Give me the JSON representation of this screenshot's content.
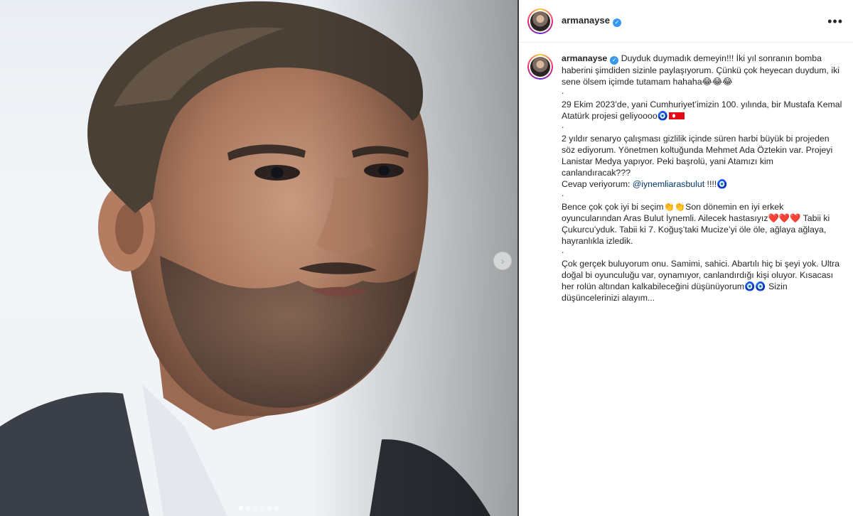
{
  "post": {
    "username": "armanayse",
    "verified_icon": "verified-badge-icon",
    "more_icon": "more-options-icon",
    "more_label": "•••"
  },
  "caption": {
    "username": "armanayse",
    "p1": "Duyduk duymadık demeyin!!! İki yıl sonranın bomba haberini şimdiden sizinle paylaşıyorum. Çünkü çok heyecan duydum, iki sene ölsem içimde tutamam hahaha😂😂😂",
    "p2_text": "29 Ekim 2023’de, yani Cumhuriyet’imizin 100. yılında, bir Mustafa Kemal Atatürk projesi geliyoooo",
    "p2_emoji": "🧿",
    "p3": "2 yıldır senaryo çalışması gizlilik içinde süren harbi büyük bi projeden söz ediyorum. Yönetmen koltuğunda Mehmet Ada Öztekin var. Projeyi Lanistar Medya yapıyor. Peki başrolü, yani Atamızı kim canlandıracak???",
    "p4_prefix": "Cevap veriyorum: ",
    "p4_mention": "@iynemliarasbulut",
    "p4_suffix": " !!!!🧿",
    "p5": "Bence çok çok iyi bi seçim👏👏Son dönemin en iyi erkek oyuncularından Aras Bulut İynemli. Ailecek hastasıyız❤️❤️❤️ Tabii ki Çukurcu’yduk. Tabii ki 7. Koğuş’taki Mucize’yi öle öle, ağlaya ağlaya, hayranlıkla izledik.",
    "p6": "Çok gerçek buluyorum onu. Samimi, sahici. Abartılı hiç bi şeyi yok. Ultra doğal bi oyunculuğu var, oynamıyor, canlandırdığı kişi oluyor. Kısacası her rolün altından kalkabileceğini düşünüyorum🧿🧿 Sizin düşüncelerinizi alayım...",
    "separator": "."
  },
  "carousel": {
    "next_label": "›",
    "dot_count": 6,
    "active_index": 0
  },
  "colors": {
    "accent_blue": "#3897f0",
    "mention": "#00376b",
    "text": "#262626"
  }
}
